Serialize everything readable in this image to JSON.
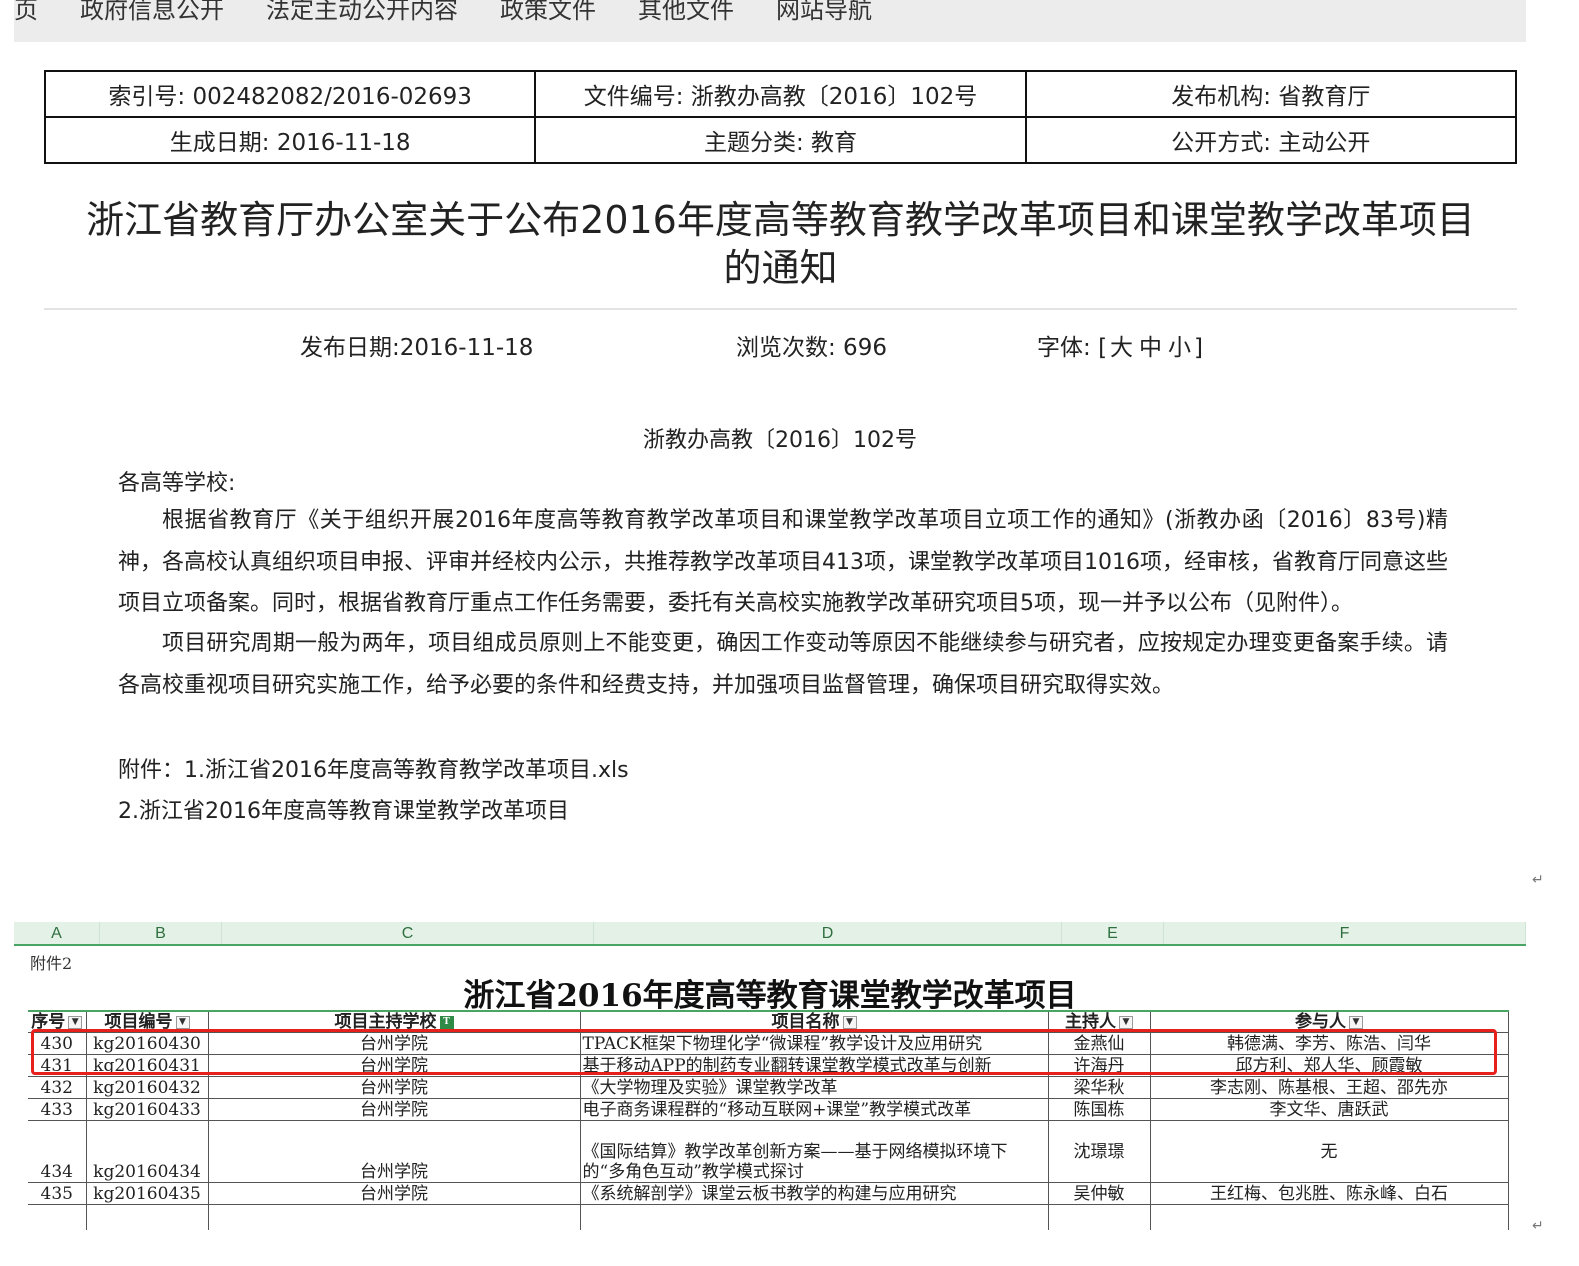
{
  "nav": {
    "items": [
      "页",
      "政府信息公开",
      "法定主动公开内容",
      "政策文件",
      "其他文件",
      "网站导航"
    ]
  },
  "meta": {
    "index_no": "索引号: 002482082/2016-02693",
    "file_no": "文件编号: 浙教办高教〔2016〕102号",
    "publisher": "发布机构: 省教育厅",
    "created": "生成日期: 2016-11-18",
    "topic": "主题分类: 教育",
    "disclosure": "公开方式: 主动公开"
  },
  "title": {
    "line1": "浙江省教育厅办公室关于公布2016年度高等教育教学改革项目和课堂教学改革项目",
    "line2": "的通知"
  },
  "info": {
    "date": "发布日期:2016-11-18",
    "views": "浏览次数: 696",
    "font_label": "字体:",
    "font_open": "[",
    "font_large": "大",
    "font_mid": "中",
    "font_small": "小",
    "font_close": "]"
  },
  "body": {
    "doc_number": "浙教办高教〔2016〕102号",
    "salutation": "各高等学校:",
    "para1": "根据省教育厅《关于组织开展2016年度高等教育教学改革项目和课堂教学改革项目立项工作的通知》(浙教办函〔2016〕83号)精神，各高校认真组织项目申报、评审并经校内公示，共推荐教学改革项目413项，课堂教学改革项目1016项，经审核，省教育厅同意这些项目立项备案。同时，根据省教育厅重点工作任务需要，委托有关高校实施教学改革研究项目5项，现一并予以公布（见附件）。",
    "para2": "项目研究周期一般为两年，项目组成员原则上不能变更，确因工作变动等原因不能继续参与研究者，应按规定办理变更备案手续。请各高校重视项目研究实施工作，给予必要的条件和经费支持，并加强项目监督管理，确保项目研究取得实效。",
    "attach1": "附件：1.浙江省2016年度高等教育教学改革项目.xls",
    "attach2": "2.浙江省2016年度高等教育课堂教学改革项目",
    "return_mark": "↵"
  },
  "sheet": {
    "columns": [
      "A",
      "B",
      "C",
      "D",
      "E",
      "F"
    ],
    "label": "附件2",
    "title": "浙江省2016年度高等教育课堂教学改革项目",
    "headers": [
      "序号",
      "项目编号",
      "项目主持学校",
      "项目名称",
      "主持人",
      "参与人"
    ],
    "rows": [
      [
        "430",
        "kg20160430",
        "台州学院",
        "TPACK框架下物理化学“微课程”教学设计及应用研究",
        "金燕仙",
        "韩德满、李芳、陈浩、闫华"
      ],
      [
        "431",
        "kg20160431",
        "台州学院",
        "基于移动APP的制药专业翻转课堂教学模式改革与创新",
        "许海丹",
        "邱方利、郑人华、顾霞敏"
      ],
      [
        "432",
        "kg20160432",
        "台州学院",
        "《大学物理及实验》课堂教学改革",
        "梁华秋",
        "李志刚、陈基根、王超、邵先亦"
      ],
      [
        "433",
        "kg20160433",
        "台州学院",
        "电子商务课程群的“移动互联网+课堂”教学模式改革",
        "陈国栋",
        "李文华、唐跃武"
      ],
      [
        "434",
        "kg20160434",
        "台州学院",
        "《国际结算》教学改革创新方案——基于网络模拟环境下|的“多角色互动”教学模式探讨",
        "沈璟璟",
        "无"
      ],
      [
        "435",
        "kg20160435",
        "台州学院",
        "《系统解剖学》课堂云板书教学的构建与应用研究",
        "吴仲敏",
        "王红梅、包兆胜、陈永峰、白石"
      ]
    ]
  },
  "colors": {
    "highlight": "#e8201c",
    "excel_green": "#4aa564"
  }
}
